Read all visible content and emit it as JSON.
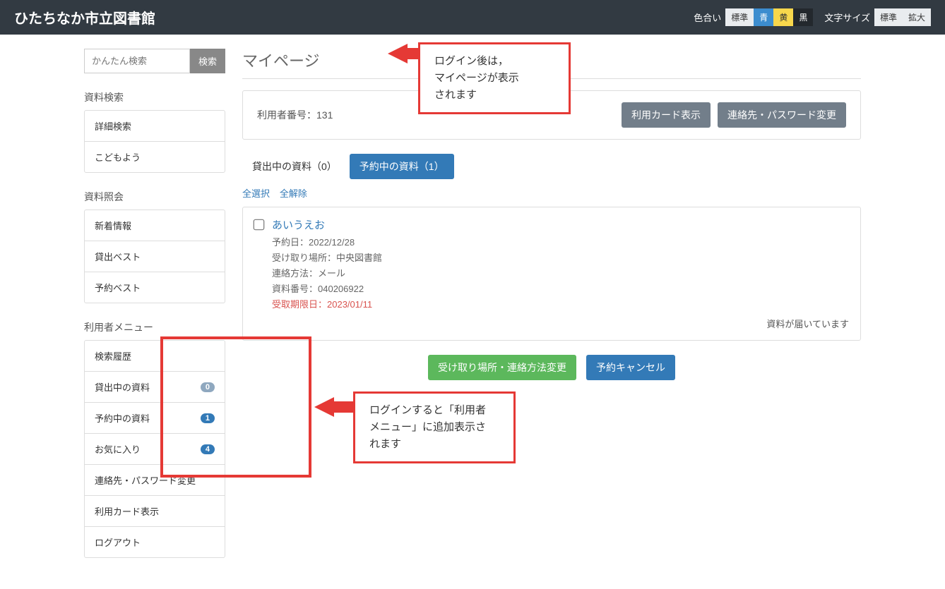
{
  "header": {
    "title": "ひたちなか市立図書館",
    "color_label": "色合い",
    "color_options": [
      "標準",
      "青",
      "黄",
      "黒"
    ],
    "fontsize_label": "文字サイズ",
    "fontsize_options": [
      "標準",
      "拡大"
    ]
  },
  "search": {
    "placeholder": "かんたん検索",
    "button": "検索"
  },
  "sidebar": {
    "sections": [
      {
        "heading": "資料検索",
        "items": [
          {
            "label": "詳細検索"
          },
          {
            "label": "こどもよう"
          }
        ]
      },
      {
        "heading": "資料照会",
        "items": [
          {
            "label": "新着情報"
          },
          {
            "label": "貸出ベスト"
          },
          {
            "label": "予約ベスト"
          }
        ]
      },
      {
        "heading": "利用者メニュー",
        "items": [
          {
            "label": "検索履歴"
          },
          {
            "label": "貸出中の資料",
            "badge": "0",
            "badge_style": "gray"
          },
          {
            "label": "予約中の資料",
            "badge": "1",
            "badge_style": "blue"
          },
          {
            "label": "お気に入り",
            "badge": "4",
            "badge_style": "blue"
          },
          {
            "label": "連絡先・パスワード変更"
          },
          {
            "label": "利用カード表示"
          },
          {
            "label": "ログアウト"
          }
        ]
      }
    ]
  },
  "main": {
    "heading": "マイページ",
    "user_label": "利用者番号：131",
    "buttons": {
      "show_card": "利用カード表示",
      "change_contact": "連絡先・パスワード変更"
    },
    "tabs": [
      {
        "label": "貸出中の資料（0）",
        "active": false
      },
      {
        "label": "予約中の資料（1）",
        "active": true
      }
    ],
    "select_all": "全選択",
    "deselect_all": "全解除",
    "reservation": {
      "title": "あいうえお",
      "reserve_date": "予約日：2022/12/28",
      "pickup": "受け取り場所：中央図書館",
      "contact": "連絡方法：メール",
      "material_no": "資料番号：040206922",
      "due": "受取期限日：2023/01/11",
      "status": "資料が届いています"
    },
    "actions": {
      "change_pickup": "受け取り場所・連絡方法変更",
      "cancel": "予約キャンセル"
    }
  },
  "callouts": {
    "top": "ログイン後は，\nマイページが表示\nされます",
    "bottom": "ログインすると「利用者\nメニュー」に追加表示さ\nれます"
  }
}
